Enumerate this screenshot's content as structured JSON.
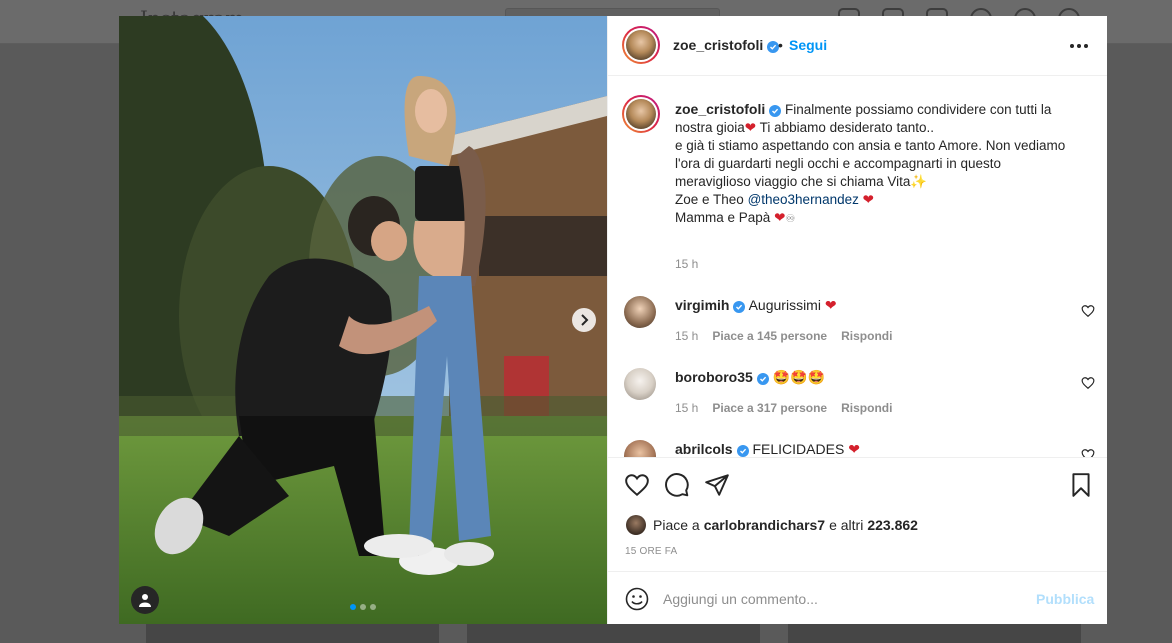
{
  "background": {
    "logo_text": "Instagram"
  },
  "post": {
    "author": "zoe_cristofoli",
    "follow_label": "Segui",
    "bullet": "•",
    "caption_lines": [
      "Finalmente possiamo condividere con tutti la",
      "nostra gioia",
      " Ti abbiamo desiderato tanto..",
      "e già ti stiamo aspettando con ansia e tanto Amore. Non vediamo",
      "l'ora di guardarti negli occhi e accompagnarti in questo",
      "meraviglioso viaggio che si chiama Vita",
      "Zoe e Theo ",
      "@theo3hernandez",
      "Mamma e Papà"
    ],
    "caption_time": "15 h",
    "carousel": {
      "slides": 3,
      "active": 0
    }
  },
  "comments": [
    {
      "user": "virgimih",
      "text": "Augurissimi",
      "emoji": "heart",
      "time": "15 h",
      "likes": "Piace a 145 persone",
      "reply": "Rispondi",
      "verified": true
    },
    {
      "user": "boroboro35",
      "text": "",
      "emoji": "star-eyes-x3",
      "time": "15 h",
      "likes": "Piace a 317 persone",
      "reply": "Rispondi",
      "verified": true
    },
    {
      "user": "abrilcols",
      "text": "FELICIDADES",
      "emoji": "heart",
      "verified": true
    }
  ],
  "likes_summary": {
    "prefix": "Piace a",
    "user": "carlobrandichars7",
    "middle": "e altri",
    "count": "223.862"
  },
  "time_ago": "15 ORE FA",
  "add_comment": {
    "placeholder": "Aggiungi un commento...",
    "publish_label": "Pubblica"
  },
  "colors": {
    "accent": "#0095f6",
    "heart_red": "#ed4956",
    "muted": "#8e8e8e",
    "publish_disabled": "#b2dffc"
  },
  "icons": [
    "heart-icon",
    "comment-icon",
    "share-icon",
    "bookmark-icon",
    "more-icon",
    "smile-icon",
    "user-tag-icon",
    "chevron-right-icon",
    "verified-icon"
  ]
}
